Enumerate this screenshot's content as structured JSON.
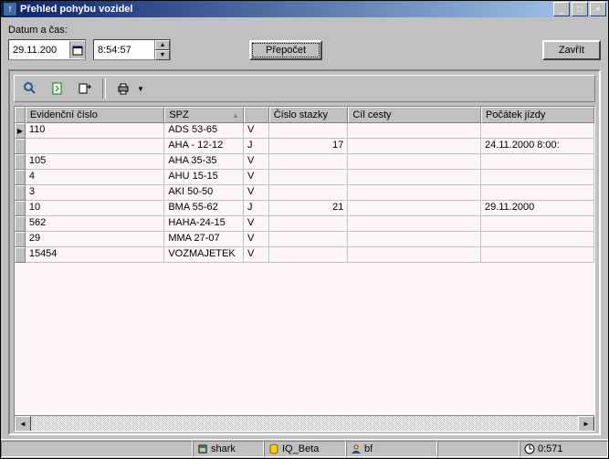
{
  "window": {
    "title": "Přehled pohybu vozidel"
  },
  "labels": {
    "datetime": "Datum a čas:"
  },
  "inputs": {
    "date": "29.11.200",
    "time": "8:54:57"
  },
  "buttons": {
    "recalc": "Přepočet",
    "close": "Zavřít"
  },
  "columns": {
    "c0": "Evidenční číslo",
    "c1": "SPZ",
    "c2": "",
    "c3": "Číslo stazky",
    "c4": "Cíl cesty",
    "c5": "Počátek jízdy"
  },
  "rows": [
    {
      "ev": "110",
      "spz": "ADS 53-65",
      "t": "V",
      "st": "",
      "cil": "",
      "poc": ""
    },
    {
      "ev": "",
      "spz": "AHA - 12-12",
      "t": "J",
      "st": "17",
      "cil": "",
      "poc": "24.11.2000 8:00:"
    },
    {
      "ev": "105",
      "spz": "AHA 35-35",
      "t": "V",
      "st": "",
      "cil": "",
      "poc": ""
    },
    {
      "ev": "4",
      "spz": "AHU 15-15",
      "t": "V",
      "st": "",
      "cil": "",
      "poc": ""
    },
    {
      "ev": "3",
      "spz": "AKI 50-50",
      "t": "V",
      "st": "",
      "cil": "",
      "poc": ""
    },
    {
      "ev": "10",
      "spz": "BMA 55-62",
      "t": "J",
      "st": "21",
      "cil": "",
      "poc": "29.11.2000"
    },
    {
      "ev": "562",
      "spz": "HAHA-24-15",
      "t": "V",
      "st": "",
      "cil": "",
      "poc": ""
    },
    {
      "ev": "29",
      "spz": "MMA 27-07",
      "t": "V",
      "st": "",
      "cil": "",
      "poc": ""
    },
    {
      "ev": "15454",
      "spz": "VOZMAJETEK",
      "t": "V",
      "st": "",
      "cil": "",
      "poc": ""
    }
  ],
  "status": {
    "s1": "shark",
    "s2": "IQ_Beta",
    "s3": "bf",
    "s5": "0:571"
  }
}
